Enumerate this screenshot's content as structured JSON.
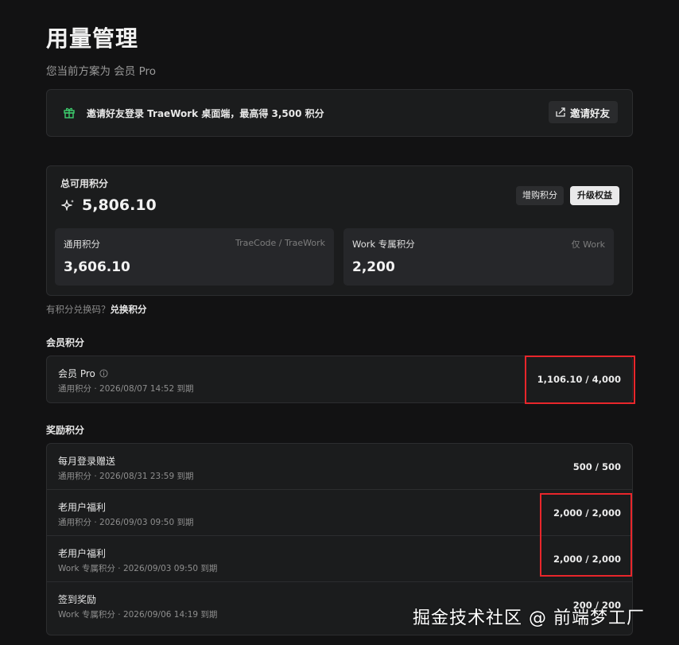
{
  "page": {
    "title": "用量管理",
    "plan_text": "您当前方案为 会员 Pro"
  },
  "invite": {
    "text": "邀请好友登录 TraeWork 桌面端，最高得 3,500 积分",
    "button_label": "邀请好友",
    "gift_color": "#3ecf6e"
  },
  "total": {
    "label": "总可用积分",
    "value": "5,806.10",
    "buy_label": "增购积分",
    "upgrade_label": "升级权益",
    "general": {
      "label": "通用积分",
      "scope": "TraeCode / TraeWork",
      "value": "3,606.10"
    },
    "work": {
      "label": "Work 专属积分",
      "scope": "仅 Work",
      "value": "2,200"
    }
  },
  "redeem": {
    "prompt": "有积分兑换码？",
    "link": "兑换积分"
  },
  "member_section": {
    "heading": "会员积分",
    "items": [
      {
        "title": "会员 Pro",
        "subtitle": "通用积分 · 2026/08/07 14:52 到期",
        "value": "1,106.10 / 4,000"
      }
    ]
  },
  "reward_section": {
    "heading": "奖励积分",
    "items": [
      {
        "title": "每月登录赠送",
        "subtitle": "通用积分 · 2026/08/31 23:59 到期",
        "value": "500 / 500"
      },
      {
        "title": "老用户福利",
        "subtitle": "通用积分 · 2026/09/03 09:50 到期",
        "value": "2,000 / 2,000"
      },
      {
        "title": "老用户福利",
        "subtitle": "Work 专属积分 · 2026/09/03 09:50 到期",
        "value": "2,000 / 2,000"
      },
      {
        "title": "签到奖励",
        "subtitle": "Work 专属积分 · 2026/09/06 14:19 到期",
        "value": "200 / 200"
      }
    ]
  },
  "annotation_color": "#e8262b",
  "watermark": "掘金技术社区 @ 前端梦工厂"
}
